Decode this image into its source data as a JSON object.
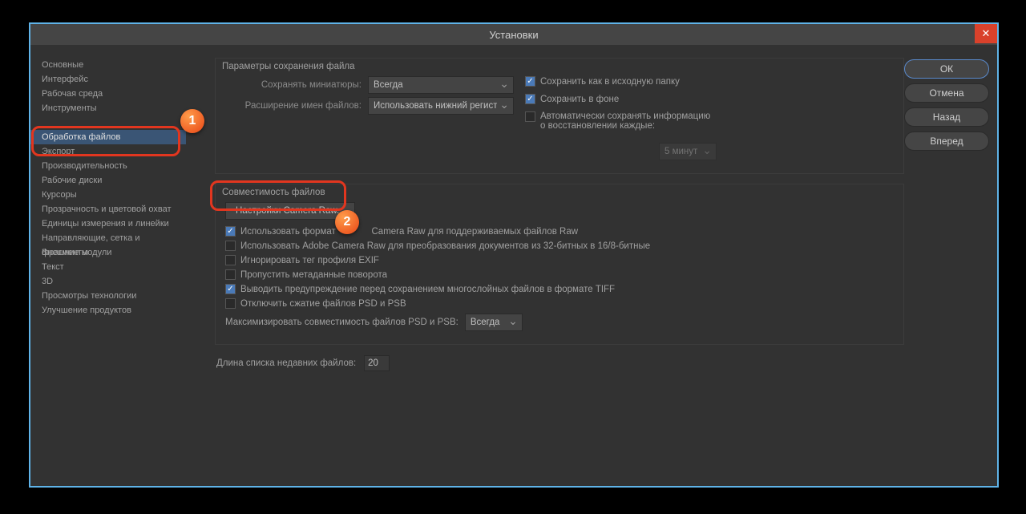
{
  "title": "Установки",
  "badge1": "1",
  "badge2": "2",
  "sidebar": {
    "items": [
      {
        "label": "Основные"
      },
      {
        "label": "Интерфейс"
      },
      {
        "label": "Рабочая среда"
      },
      {
        "label": "Инструменты"
      },
      {
        "label": ""
      },
      {
        "label": "Обработка файлов"
      },
      {
        "label": "Экспорт"
      },
      {
        "label": "Производительность"
      },
      {
        "label": "Рабочие диски"
      },
      {
        "label": "Курсоры"
      },
      {
        "label": "Прозрачность и цветовой охват"
      },
      {
        "label": "Единицы измерения и линейки"
      },
      {
        "label": "Направляющие, сетка и фрагменты"
      },
      {
        "label": "Внешние модули"
      },
      {
        "label": "Текст"
      },
      {
        "label": "3D"
      },
      {
        "label": "Просмотры технологии"
      },
      {
        "label": "Улучшение продуктов"
      }
    ]
  },
  "buttons": {
    "ok": "ОК",
    "cancel": "Отмена",
    "back": "Назад",
    "fwd": "Вперед"
  },
  "group1": {
    "title": "Параметры сохранения файла",
    "thumb_label": "Сохранять миниатюры:",
    "thumb_value": "Всегда",
    "ext_label": "Расширение имен файлов:",
    "ext_value": "Использовать нижний регистр",
    "chk_original": "Сохранить как в исходную папку",
    "chk_bg": "Сохранить в фоне",
    "chk_auto": "Автоматически сохранять информацию о восстановлении каждые:",
    "interval": "5 минут"
  },
  "group2": {
    "title": "Совместимость файлов",
    "camera_raw_btn": "Настройки Camera Raw...",
    "chk1": "Использовать формат              Camera Raw для поддерживаемых файлов Raw",
    "chk2": "Использовать Adobe Camera Raw для преобразования документов из 32-битных в 16/8-битные",
    "chk3": "Игнорировать тег профиля EXIF",
    "chk4": "Пропустить метаданные поворота",
    "chk5": "Выводить предупреждение перед сохранением многослойных файлов в формате TIFF",
    "chk6": "Отключить сжатие файлов PSD и PSB",
    "max_label": "Максимизировать совместимость файлов PSD и PSB:",
    "max_value": "Всегда"
  },
  "recent": {
    "label": "Длина списка недавних файлов:",
    "value": "20"
  }
}
